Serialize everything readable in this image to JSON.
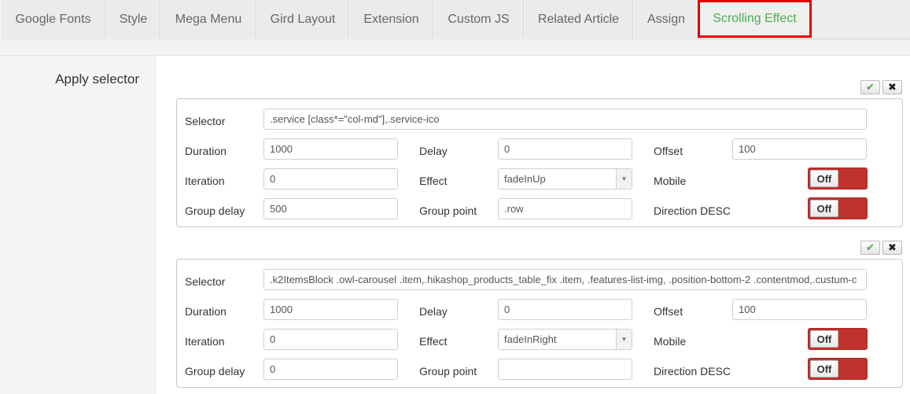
{
  "tabs": [
    {
      "label": "Google Fonts"
    },
    {
      "label": "Style"
    },
    {
      "label": "Mega Menu"
    },
    {
      "label": "Gird Layout"
    },
    {
      "label": "Extension"
    },
    {
      "label": "Custom JS"
    },
    {
      "label": "Related Article"
    },
    {
      "label": "Assign"
    },
    {
      "label": "Scrolling Effect"
    }
  ],
  "active_tab": "Scrolling Effect",
  "section_label": "Apply selector",
  "labels": {
    "selector": "Selector",
    "duration": "Duration",
    "delay": "Delay",
    "offset": "Offset",
    "iteration": "Iteration",
    "effect": "Effect",
    "mobile": "Mobile",
    "group_delay": "Group delay",
    "group_point": "Group point",
    "direction_desc": "Direction DESC"
  },
  "icons": {
    "confirm": "check-icon",
    "remove": "close-icon"
  },
  "glyphs": {
    "check": "✔",
    "close": "✖",
    "arrow": "▼"
  },
  "colors": {
    "accent_green": "#4caf50",
    "toggle_off": "#c0322d",
    "highlight_border": "#e00000"
  },
  "panels": [
    {
      "selector": ".service [class*=\"col-md\"],.service-ico",
      "duration": "1000",
      "delay": "0",
      "offset": "100",
      "iteration": "0",
      "effect": "fadeInUp",
      "mobile": "Off",
      "group_delay": "500",
      "group_point": ".row",
      "direction_desc": "Off"
    },
    {
      "selector": ".k2ItemsBlock .owl-carousel .item,.hikashop_products_table_fix .item, .features-list-img, .position-bottom-2 .contentmod,.custum-c",
      "duration": "1000",
      "delay": "0",
      "offset": "100",
      "iteration": "0",
      "effect": "fadeInRight",
      "mobile": "Off",
      "group_delay": "0",
      "group_point": "",
      "direction_desc": "Off"
    }
  ]
}
